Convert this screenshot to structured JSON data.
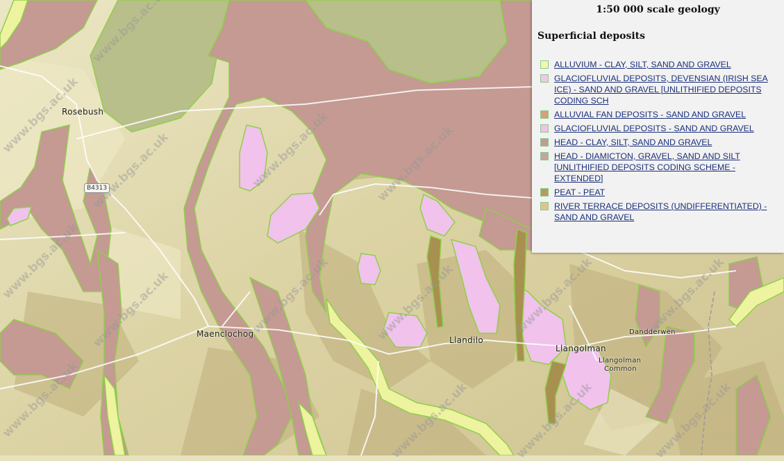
{
  "map": {
    "places": [
      {
        "id": "rosebush",
        "label": "Rosebush"
      },
      {
        "id": "maenclochog",
        "label": "Maenclochog"
      },
      {
        "id": "llandilo",
        "label": "Llandilo"
      },
      {
        "id": "llangolman",
        "label": "Llangolman"
      },
      {
        "id": "llangolman-common-1",
        "label": "Llangolman"
      },
      {
        "id": "llangolman-common-2",
        "label": "Common"
      },
      {
        "id": "dandderwen",
        "label": "Dandderwen"
      }
    ],
    "road_label": "B4313",
    "watermark": "www.bgs.ac.uk"
  },
  "legend": {
    "title": "1:50 000 scale geology",
    "section": "Superficial deposits",
    "items": [
      {
        "label": "ALLUVIUM - CLAY, SILT, SAND AND GRAVEL",
        "color": "#f4f7a8"
      },
      {
        "label": "GLACIOFLUVIAL DEPOSITS, DEVENSIAN (IRISH SEA ICE) - SAND AND GRAVEL [UNLITHIFIED DEPOSITS CODING SCH",
        "color": "#f4c4ee"
      },
      {
        "label": "ALLUVIAL FAN DEPOSITS - SAND AND GRAVEL",
        "color": "#d9a07a"
      },
      {
        "label": "GLACIOFLUVIAL DEPOSITS - SAND AND GRAVEL",
        "color": "#f4c0ef"
      },
      {
        "label": "HEAD - CLAY, SILT, SAND AND GRAVEL",
        "color": "#c49a96"
      },
      {
        "label": "HEAD - DIAMICTON, GRAVEL, SAND AND SILT [UNLITHIFIED DEPOSITS CODING SCHEME - EXTENDED]",
        "color": "#c8a29f"
      },
      {
        "label": "PEAT - PEAT",
        "color": "#b89a5e"
      },
      {
        "label": "RIVER TERRACE DEPOSITS (UNDIFFERENTIATED) - SAND AND GRAVEL",
        "color": "#e6c091"
      }
    ]
  }
}
